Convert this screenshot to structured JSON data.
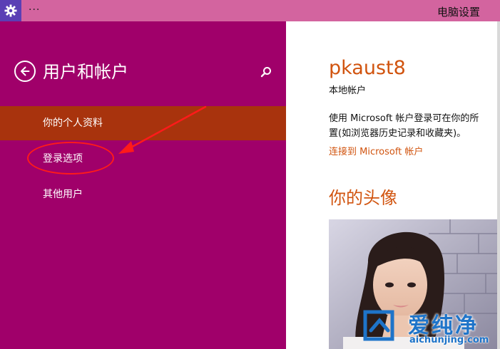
{
  "window": {
    "title": "电脑设置",
    "menu_dots": "···",
    "app_icon": "gear-icon"
  },
  "sidebar": {
    "heading": "用户和帐户",
    "back_icon": "back-arrow-icon",
    "search_icon": "search-icon",
    "items": [
      {
        "label": "你的个人资料",
        "selected": true
      },
      {
        "label": "登录选项",
        "selected": false
      },
      {
        "label": "其他用户",
        "selected": false
      }
    ]
  },
  "content": {
    "user_name": "pkaust8",
    "account_type": "本地帐户",
    "description_lines": [
      "使用 Microsoft 帐户登录可在你的所",
      "置(如浏览器历史记录和收藏夹)。"
    ],
    "connect_link": "连接到 Microsoft 帐户",
    "avatar_heading": "你的头像"
  },
  "watermark": {
    "title": "爱纯净",
    "domain": "aichunjing.com"
  },
  "colors": {
    "titlebar": "#d3649f",
    "sidebar_bg": "#a0006a",
    "selected_item": "#a8330d",
    "accent": "#d1540f",
    "annotation": "#ff1a1a"
  }
}
